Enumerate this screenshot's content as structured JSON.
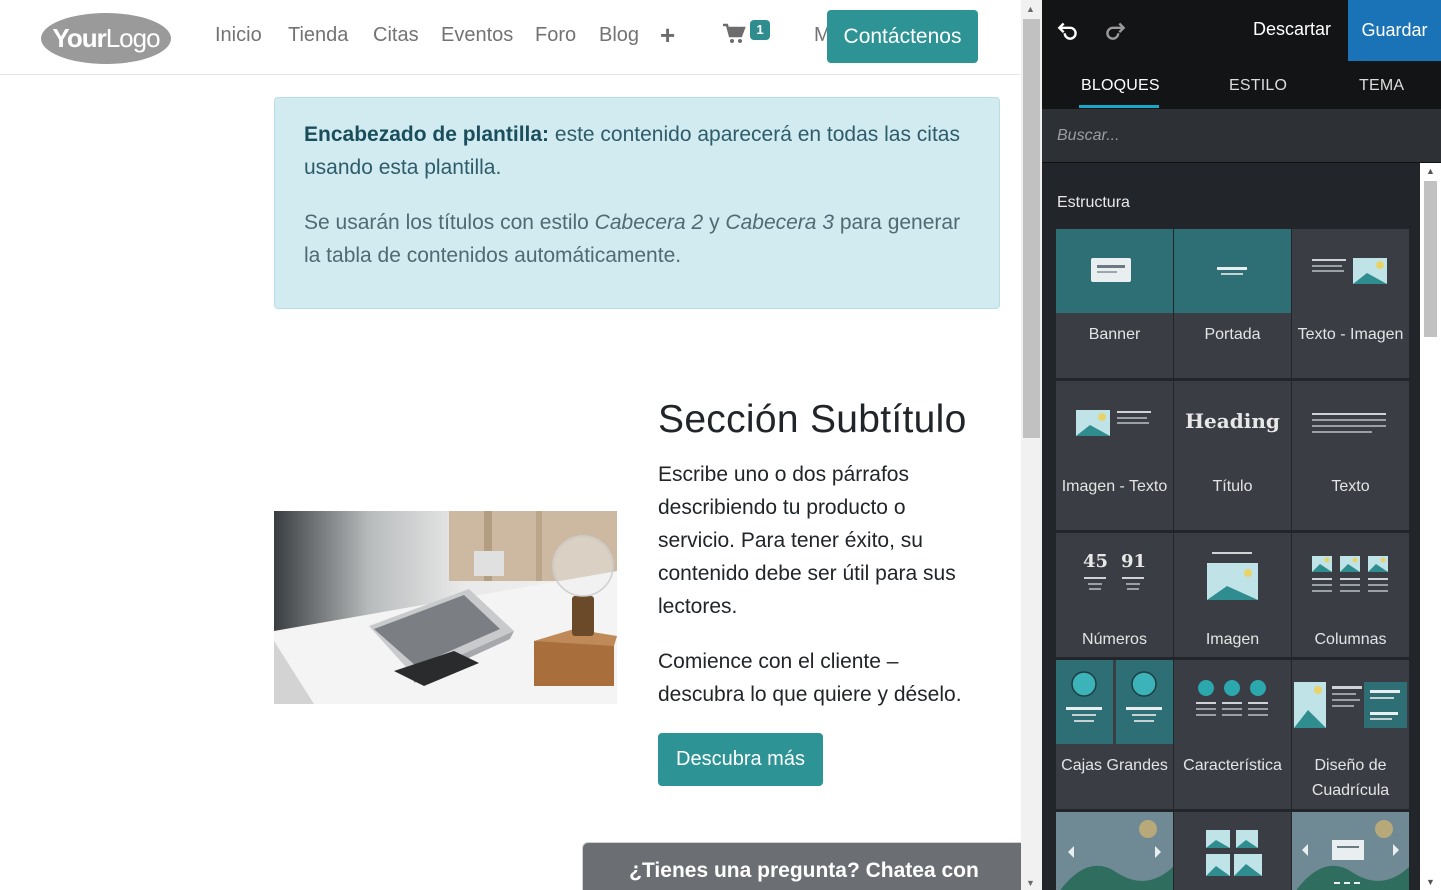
{
  "navbar": {
    "logo_text_bold": "Your",
    "logo_text_light": "Logo",
    "links": [
      "Inicio",
      "Tienda",
      "Citas",
      "Eventos",
      "Foro",
      "Blog"
    ],
    "plus": "+",
    "cart_count": "1",
    "overflow_letter": "M",
    "contact_label": "Contáctenos"
  },
  "alert": {
    "strong": "Encabezado de plantilla:",
    "p1_rest": " este contenido aparecerá en todas las citas usando esta plantilla.",
    "p2_a": "Se usarán los títulos con estilo ",
    "p2_em1": "Cabecera 2",
    "p2_b": " y ",
    "p2_em2": "Cabecera 3",
    "p2_c": " para generar la tabla de contenidos automáticamente."
  },
  "section": {
    "title": "Sección Subtítulo",
    "p1": "Escribe uno o dos párrafos describiendo tu producto o servicio. Para tener éxito, su contenido debe ser útil para sus lectores.",
    "p2": "Comience con el cliente – descubra lo que quiere y déselo.",
    "button": "Descubra más"
  },
  "chat": {
    "label": "¿Tienes una pregunta? Chatea con nosotros."
  },
  "editor": {
    "discard": "Descartar",
    "save": "Guardar",
    "tabs": [
      "BLOQUES",
      "ESTILO",
      "TEMA"
    ],
    "active_tab": "BLOQUES",
    "search_placeholder": "Buscar...",
    "section_label": "Estructura",
    "heading_thumb": "Heading",
    "numbers_thumb": [
      "45",
      "91"
    ],
    "blocks": [
      "Banner",
      "Portada",
      "Texto - Imagen",
      "Imagen - Texto",
      "Título",
      "Texto",
      "Números",
      "Imagen",
      "Columnas",
      "Cajas Grandes",
      "Característica",
      "Diseño de Cuadrícula"
    ]
  },
  "colors": {
    "primary": "#2e9395",
    "save_blue": "#1a73b6",
    "tab_accent": "#1aa4c8",
    "alert_bg": "#d2ebf0",
    "editor_bg": "#22252a"
  }
}
